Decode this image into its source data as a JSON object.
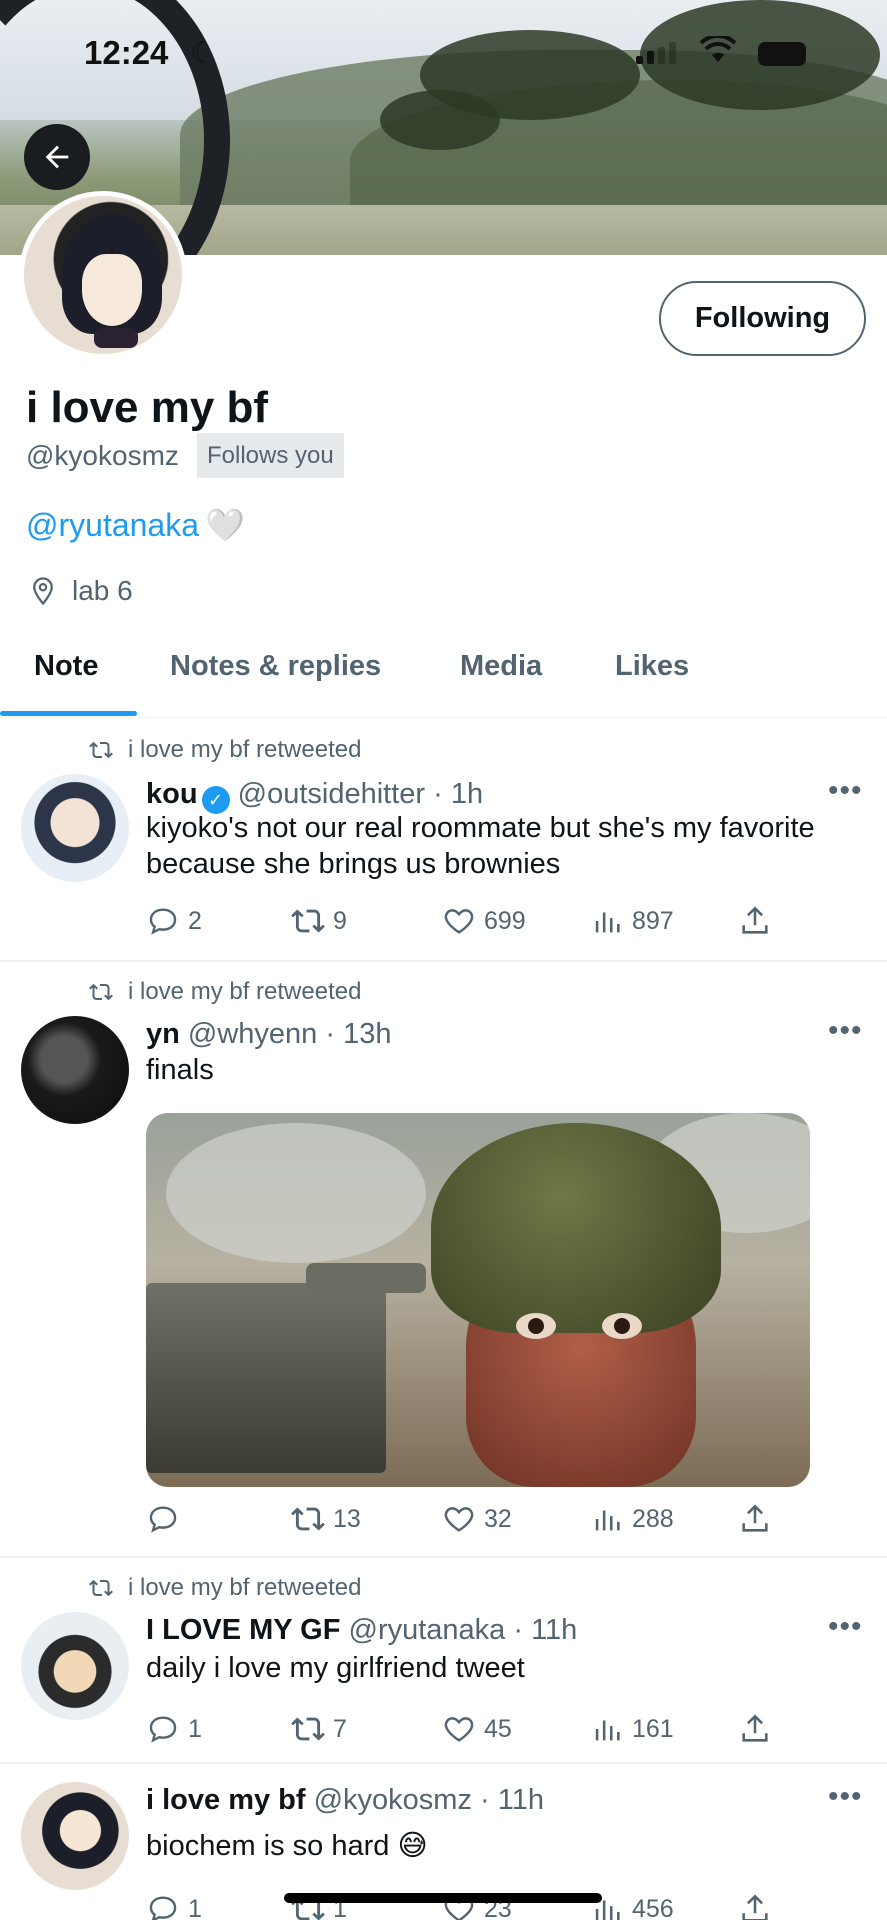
{
  "status_bar": {
    "time": "12:24"
  },
  "profile": {
    "display_name": "i love my bf",
    "handle": "@kyokosmz",
    "follows_you": "Follows you",
    "follow_button": "Following",
    "bio_mention": "@ryutanaka",
    "bio_emoji": "🤍",
    "location": "lab 6"
  },
  "tabs": [
    {
      "label": "Note",
      "active": true
    },
    {
      "label": "Notes & replies",
      "active": false
    },
    {
      "label": "Media",
      "active": false
    },
    {
      "label": "Likes",
      "active": false
    }
  ],
  "tweets": [
    {
      "retweet_label": "i love my bf retweeted",
      "name": "kou",
      "verified": true,
      "handle_time": "@outsidehitter · 1h",
      "text": "kiyoko's not our real roommate but she's my favorite because she brings us brownies",
      "replies": "2",
      "retweets": "9",
      "likes": "699",
      "views": "897"
    },
    {
      "retweet_label": "i love my bf retweeted",
      "name": "yn",
      "handle_time": "@whyenn · 13h",
      "text": "finals",
      "replies": "",
      "retweets": "13",
      "likes": "32",
      "views": "288"
    },
    {
      "retweet_label": "i love my bf retweeted",
      "name": "I LOVE MY GF",
      "handle_time": "@ryutanaka · 11h",
      "text": "daily i love my girlfriend tweet",
      "replies": "1",
      "retweets": "7",
      "likes": "45",
      "views": "161"
    },
    {
      "name": "i love my bf",
      "handle_time": "@kyokosmz · 11h",
      "text": "biochem is so hard 😅",
      "replies": "1",
      "retweets": "1",
      "likes": "23",
      "views": "456"
    }
  ],
  "colors": {
    "accent": "#1d9bf0",
    "secondary_text": "#536471",
    "primary_text": "#0f1419"
  },
  "icons": [
    "back-arrow-icon",
    "location-pin-icon",
    "retweet-icon",
    "reply-icon",
    "like-icon",
    "views-icon",
    "share-icon",
    "more-icon",
    "verified-badge-icon"
  ]
}
